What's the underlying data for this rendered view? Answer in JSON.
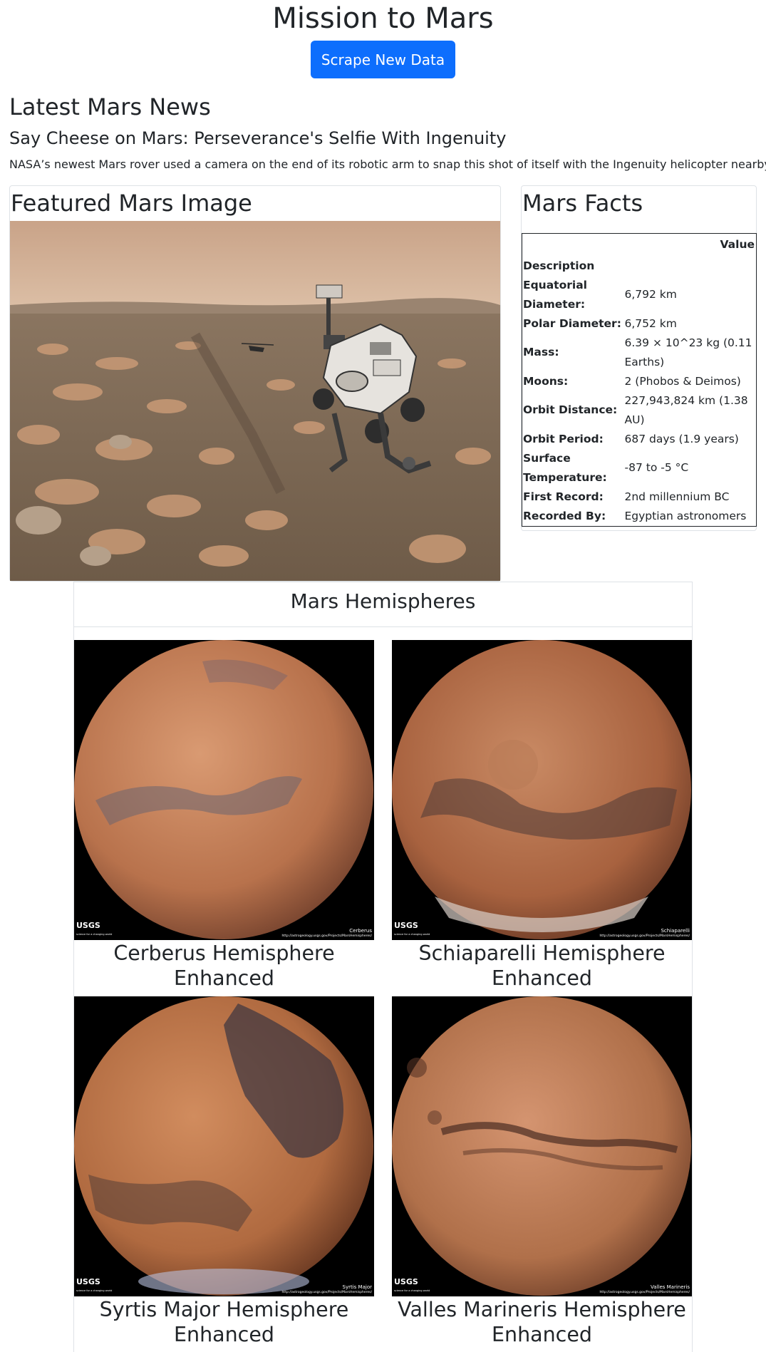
{
  "header": {
    "title": "Mission to Mars",
    "scrape_button": "Scrape New Data"
  },
  "news": {
    "heading": "Latest Mars News",
    "title": "Say Cheese on Mars: Perseverance's Selfie With Ingenuity",
    "teaser": "NASA’s newest Mars rover used a camera on the end of its robotic arm to snap this shot of itself with the Ingenuity helicopter nearby."
  },
  "featured": {
    "heading": "Featured Mars Image"
  },
  "facts": {
    "heading": "Mars Facts",
    "column_header": "Value",
    "index_header": "Description",
    "rows": [
      {
        "label": "Equatorial Diameter:",
        "value": "6,792 km"
      },
      {
        "label": "Polar Diameter:",
        "value": "6,752 km"
      },
      {
        "label": "Mass:",
        "value": "6.39 × 10^23 kg (0.11 Earths)"
      },
      {
        "label": "Moons:",
        "value": "2 (Phobos & Deimos)"
      },
      {
        "label": "Orbit Distance:",
        "value": "227,943,824 km (1.38 AU)"
      },
      {
        "label": "Orbit Period:",
        "value": "687 days (1.9 years)"
      },
      {
        "label": "Surface Temperature:",
        "value": "-87 to -5 °C"
      },
      {
        "label": "First Record:",
        "value": "2nd millennium BC"
      },
      {
        "label": "Recorded By:",
        "value": "Egyptian astronomers"
      }
    ]
  },
  "hemispheres": {
    "heading": "Mars Hemispheres",
    "logo_text": "USGS",
    "logo_tagline": "science for a changing world",
    "items": [
      {
        "title": "Cerberus Hemisphere Enhanced",
        "image_label": "Cerberus",
        "image_url": "http://astrogeology.usgs.gov/Projects/MarsHemispheres/"
      },
      {
        "title": "Schiaparelli Hemisphere Enhanced",
        "image_label": "Schiaparelli",
        "image_url": "http://astrogeology.usgs.gov/Projects/MarsHemispheres/"
      },
      {
        "title": "Syrtis Major Hemisphere Enhanced",
        "image_label": "Syrtis Major",
        "image_url": "http://astrogeology.usgs.gov/Projects/MarsHemispheres/"
      },
      {
        "title": "Valles Marineris Hemisphere Enhanced",
        "image_label": "Valles Marineris",
        "image_url": "http://astrogeology.usgs.gov/Projects/MarsHemispheres/"
      }
    ]
  }
}
